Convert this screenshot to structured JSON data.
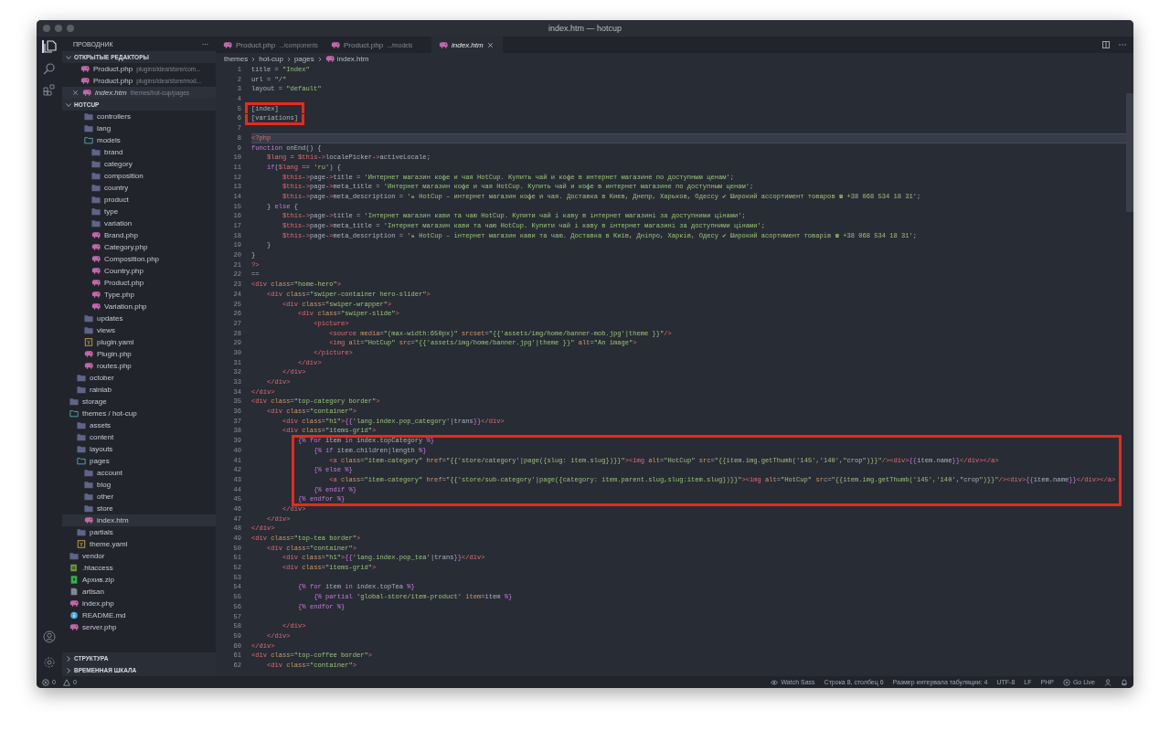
{
  "window": {
    "title": "index.htm — hotcup"
  },
  "sidebar": {
    "title": "ПРОВОДНИК",
    "more": "···",
    "open_editors": {
      "title": "ОТКРЫТЫЕ РЕДАКТОРЫ",
      "expanded": true,
      "items": [
        {
          "kind": "php",
          "name": "Product.php",
          "path": "plugins/idea/store/com...",
          "selected": false,
          "preview": false
        },
        {
          "kind": "php",
          "name": "Product.php",
          "path": "plugins/idea/store/mod...",
          "selected": false,
          "preview": false
        },
        {
          "kind": "php",
          "name": "index.htm",
          "path": "themes/hot-cup/pages",
          "selected": true,
          "preview": true
        }
      ]
    },
    "project": {
      "title": "HOTCUP",
      "expanded": true,
      "tree": [
        {
          "children": [
            {
              "children": [
                {
                  "kind": "folder",
                  "label": "controllers",
                  "expanded": false,
                  "selected": false
                },
                {
                  "kind": "folder",
                  "label": "lang",
                  "expanded": false,
                  "selected": false
                },
                {
                  "kind": "folder",
                  "label": "models",
                  "expanded": true,
                  "selected": false,
                  "children": [
                    {
                      "kind": "folder",
                      "label": "brand",
                      "expanded": false,
                      "selected": false
                    },
                    {
                      "kind": "folder",
                      "label": "category",
                      "expanded": false,
                      "selected": false
                    },
                    {
                      "kind": "folder",
                      "label": "composition",
                      "expanded": false,
                      "selected": false
                    },
                    {
                      "kind": "folder",
                      "label": "country",
                      "expanded": false,
                      "selected": false
                    },
                    {
                      "kind": "folder",
                      "label": "product",
                      "expanded": false,
                      "selected": false
                    },
                    {
                      "kind": "folder",
                      "label": "type",
                      "expanded": false,
                      "selected": false
                    },
                    {
                      "kind": "folder",
                      "label": "variation",
                      "expanded": false,
                      "selected": false
                    },
                    {
                      "kind": "php",
                      "label": "Brand.php",
                      "selected": false
                    },
                    {
                      "kind": "php",
                      "label": "Category.php",
                      "selected": false
                    },
                    {
                      "kind": "php",
                      "label": "Composition.php",
                      "selected": false
                    },
                    {
                      "kind": "php",
                      "label": "Country.php",
                      "selected": false
                    },
                    {
                      "kind": "php",
                      "label": "Product.php",
                      "selected": false
                    },
                    {
                      "kind": "php",
                      "label": "Type.php",
                      "selected": false
                    },
                    {
                      "kind": "php",
                      "label": "Variation.php",
                      "selected": false
                    }
                  ]
                },
                {
                  "kind": "folder",
                  "label": "updates",
                  "expanded": false,
                  "selected": false
                },
                {
                  "kind": "folder",
                  "label": "views",
                  "expanded": false,
                  "selected": false
                },
                {
                  "kind": "yaml",
                  "label": "plugin.yaml",
                  "selected": false
                },
                {
                  "kind": "php",
                  "label": "Plugin.php",
                  "selected": false
                },
                {
                  "kind": "php",
                  "label": "routes.php",
                  "selected": false
                }
              ]
            },
            {
              "kind": "folder",
              "label": "october",
              "expanded": false,
              "selected": false
            },
            {
              "kind": "folder",
              "label": "rainlab",
              "expanded": false,
              "selected": false
            }
          ]
        },
        {
          "kind": "folder",
          "label": "storage",
          "expanded": false,
          "selected": false
        },
        {
          "kind": "folder",
          "label": "themes / hot-cup",
          "expanded": true,
          "selected": false,
          "children": [
            {
              "kind": "folder",
              "label": "assets",
              "expanded": false,
              "selected": false
            },
            {
              "kind": "folder",
              "label": "content",
              "expanded": false,
              "selected": false
            },
            {
              "kind": "folder",
              "label": "layouts",
              "expanded": false,
              "selected": false
            },
            {
              "kind": "folder",
              "label": "pages",
              "expanded": true,
              "selected": false,
              "children": [
                {
                  "kind": "folder",
                  "label": "account",
                  "expanded": false,
                  "selected": false
                },
                {
                  "kind": "folder",
                  "label": "blog",
                  "expanded": false,
                  "selected": false
                },
                {
                  "kind": "folder",
                  "label": "other",
                  "expanded": false,
                  "selected": false
                },
                {
                  "kind": "folder",
                  "label": "store",
                  "expanded": false,
                  "selected": false
                },
                {
                  "kind": "php",
                  "label": "index.htm",
                  "selected": true
                }
              ]
            },
            {
              "kind": "folder",
              "label": "partials",
              "expanded": false,
              "selected": false
            },
            {
              "kind": "yaml",
              "label": "theme.yaml",
              "selected": false
            }
          ]
        },
        {
          "kind": "folder",
          "label": "vendor",
          "expanded": false,
          "selected": false
        },
        {
          "kind": "htaccess",
          "label": ".htaccess",
          "selected": false
        },
        {
          "kind": "zip",
          "label": "Архив.zip",
          "selected": false
        },
        {
          "kind": "file",
          "label": "artisan",
          "selected": false
        },
        {
          "kind": "php",
          "label": "index.php",
          "selected": false
        },
        {
          "kind": "info",
          "label": "README.md",
          "selected": false
        },
        {
          "kind": "php",
          "label": "server.php",
          "selected": false
        }
      ]
    },
    "bottom_sections": [
      {
        "title": "СТРУКТУРА",
        "expanded": false
      },
      {
        "title": "ВРЕМЕННАЯ ШКАЛА",
        "expanded": false
      }
    ]
  },
  "tabs": [
    {
      "kind": "php",
      "label": "Product.php",
      "description": ".../components",
      "selected": false,
      "preview": false
    },
    {
      "kind": "php",
      "label": "Product.php",
      "description": ".../models",
      "selected": false,
      "preview": false
    },
    {
      "kind": "php",
      "label": "index.htm",
      "selected": true,
      "preview": true
    }
  ],
  "breadcrumb": [
    {
      "kind": "folder",
      "label": "themes"
    },
    {
      "kind": "folder",
      "label": "hot-cup"
    },
    {
      "kind": "folder",
      "label": "pages"
    },
    {
      "kind": "php",
      "label": "index.htm"
    }
  ],
  "code_lines": [
    {
      "number": "1",
      "text": "title = \"Index\"",
      "current": false,
      "boxed": false
    },
    {
      "number": "2",
      "text": "url = \"/\"",
      "current": false,
      "boxed": false
    },
    {
      "number": "3",
      "text": "layout = \"default\"",
      "current": false,
      "boxed": false
    },
    {
      "number": "4",
      "current": false,
      "boxed": false
    },
    {
      "number": "5",
      "text": "[index]",
      "current": false,
      "boxed": true
    },
    {
      "number": "6",
      "text": "[variations]",
      "current": false,
      "boxed": true
    },
    {
      "number": "7",
      "current": false,
      "boxed": false
    },
    {
      "number": "8",
      "text": "<?php",
      "current": true,
      "boxed": false
    },
    {
      "number": "9",
      "text": "function onEnd() {",
      "current": false,
      "boxed": false
    },
    {
      "number": "10",
      "text": "    $lang = $this->localePicker->activeLocale;",
      "current": false,
      "boxed": false
    },
    {
      "number": "11",
      "text": "    if($lang == 'ru') {",
      "current": false,
      "boxed": false
    },
    {
      "number": "12",
      "text": "        $this->page->title = 'Интернет магазин кофе и чая HotCup. Купить чай и кофе в интернет магазине по доступным ценам';",
      "current": false,
      "boxed": false
    },
    {
      "number": "13",
      "text": "        $this->page->meta_title = 'Интернет магазин кофе и чая HotCup. Купить чай и кофе в интернет магазине по доступным ценам';",
      "current": false,
      "boxed": false
    },
    {
      "number": "14",
      "text": "        $this->page->meta_description = '☕ HotCup – интернет магазин кофе и чая. Доставка в Киев, Днепр, Харьков, Одессу ✔ Широкий ассортимент товаров ☎ +38 068 534 18 31';",
      "current": false,
      "boxed": false
    },
    {
      "number": "15",
      "text": "    } else {",
      "current": false,
      "boxed": false
    },
    {
      "number": "16",
      "text": "        $this->page->title = 'Інтернет магазин кави та чаю HotCup. Купити чай і каву в інтернет магазині за доступними цінами';",
      "current": false,
      "boxed": false
    },
    {
      "number": "17",
      "text": "        $this->page->meta_title = 'Інтернет магазин кави та чаю HotCup. Купити чай і каву в інтернет магазині за доступними цінами';",
      "current": false,
      "boxed": false
    },
    {
      "number": "18",
      "text": "        $this->page->meta_description = '☕ HotCup – інтернет магазин кави та чаю. Доставка в Київ, Дніпро, Харків, Одесу ✔ Широкий асортимент товарів ☎ +38 068 534 18 31';",
      "current": false,
      "boxed": false
    },
    {
      "number": "19",
      "text": "    }",
      "current": false,
      "boxed": false
    },
    {
      "number": "20",
      "text": "}",
      "current": false,
      "boxed": false
    },
    {
      "number": "21",
      "text": "?>",
      "current": false,
      "boxed": false
    },
    {
      "number": "22",
      "text": "==",
      "current": false,
      "boxed": false
    },
    {
      "number": "23",
      "text": "<div class=\"home-hero\">",
      "current": false,
      "boxed": false
    },
    {
      "number": "24",
      "text": "    <div class=\"swiper-container hero-slider\">",
      "current": false,
      "boxed": false
    },
    {
      "number": "25",
      "text": "        <div class=\"swiper-wrapper\">",
      "current": false,
      "boxed": false
    },
    {
      "number": "26",
      "text": "            <div class=\"swiper-slide\">",
      "current": false,
      "boxed": false
    },
    {
      "number": "27",
      "text": "                <picture>",
      "current": false,
      "boxed": false
    },
    {
      "number": "28",
      "text": "                    <source media=\"(max-width:650px)\" srcset=\"{{'assets/img/home/banner-mob.jpg'|theme }}\"/>",
      "current": false,
      "boxed": false
    },
    {
      "number": "29",
      "text": "                    <img alt=\"HotCup\" src=\"{{'assets/img/home/banner.jpg'|theme }}\" alt=\"An image\">",
      "current": false,
      "boxed": false
    },
    {
      "number": "30",
      "text": "                </picture>",
      "current": false,
      "boxed": false
    },
    {
      "number": "31",
      "text": "            </div>",
      "current": false,
      "boxed": false
    },
    {
      "number": "32",
      "text": "        </div>",
      "current": false,
      "boxed": false
    },
    {
      "number": "33",
      "text": "    </div>",
      "current": false,
      "boxed": false
    },
    {
      "number": "34",
      "text": "</div>",
      "current": false,
      "boxed": false
    },
    {
      "number": "35",
      "text": "<div class=\"top-category border\">",
      "current": false,
      "boxed": false
    },
    {
      "number": "36",
      "text": "    <div class=\"container\">",
      "current": false,
      "boxed": false
    },
    {
      "number": "37",
      "text": "        <div class=\"h1\">{{'lang.index.pop_category'|trans}}</div>",
      "current": false,
      "boxed": false
    },
    {
      "number": "38",
      "text": "        <div class=\"items-grid\">",
      "current": false,
      "boxed": false
    },
    {
      "number": "39",
      "text": "            {% for item in index.topCategory %}",
      "current": false,
      "boxed": true
    },
    {
      "number": "40",
      "text": "                {% if item.children|length %}",
      "current": false,
      "boxed": true
    },
    {
      "number": "41",
      "text": "                    <a class=\"item-category\" href=\"{{'store/category'|page({slug: item.slug})}}\"><img alt=\"HotCup\" src=\"{{item.img.getThumb('145','140',\"crop\")}}\"/><div>{{item.name}}</div></a>",
      "current": false,
      "boxed": true
    },
    {
      "number": "42",
      "text": "                {% else %}",
      "current": false,
      "boxed": true
    },
    {
      "number": "43",
      "text": "                    <a class=\"item-category\" href=\"{{'store/sub-category'|page({category: item.parent.slug,slug:item.slug})}}\"><img alt=\"HotCup\" src=\"{{item.img.getThumb('145','140',\"crop\")}}\"/><div>{{item.name}}</div></a>",
      "current": false,
      "boxed": true
    },
    {
      "number": "44",
      "text": "                {% endif %}",
      "current": false,
      "boxed": true
    },
    {
      "number": "45",
      "text": "            {% endfor %}",
      "current": false,
      "boxed": true
    },
    {
      "number": "46",
      "text": "        </div>",
      "current": false,
      "boxed": false
    },
    {
      "number": "47",
      "text": "    </div>",
      "current": false,
      "boxed": false
    },
    {
      "number": "48",
      "text": "</div>",
      "current": false,
      "boxed": false
    },
    {
      "number": "49",
      "text": "<div class=\"top-tea border\">",
      "current": false,
      "boxed": false
    },
    {
      "number": "50",
      "text": "    <div class=\"container\">",
      "current": false,
      "boxed": false
    },
    {
      "number": "51",
      "text": "        <div class=\"h1\">{{'lang.index.pop_tea'|trans}}</div>",
      "current": false,
      "boxed": false
    },
    {
      "number": "52",
      "text": "        <div class=\"items-grid\">",
      "current": false,
      "boxed": false
    },
    {
      "number": "53",
      "current": false,
      "boxed": false
    },
    {
      "number": "54",
      "text": "            {% for item in index.topTea %}",
      "current": false,
      "boxed": false
    },
    {
      "number": "55",
      "text": "                {% partial 'global-store/item-product' item=item %}",
      "current": false,
      "boxed": false
    },
    {
      "number": "56",
      "text": "            {% endfor %}",
      "current": false,
      "boxed": false
    },
    {
      "number": "57",
      "current": false,
      "boxed": false
    },
    {
      "number": "58",
      "text": "        </div>",
      "current": false,
      "boxed": false
    },
    {
      "number": "59",
      "text": "    </div>",
      "current": false,
      "boxed": false
    },
    {
      "number": "60",
      "text": "</div>",
      "current": false,
      "boxed": false
    },
    {
      "number": "61",
      "text": "<div class=\"top-coffee border\">",
      "current": false,
      "boxed": false
    },
    {
      "number": "62",
      "text": "    <div class=\"container\">",
      "current": false,
      "boxed": false
    }
  ],
  "status_bar": {
    "problems": [
      {
        "kind": "error",
        "count": "0"
      },
      {
        "kind": "warning",
        "count": "0"
      }
    ],
    "items": [
      {
        "kind": "eye",
        "label": "Watch Sass"
      },
      {
        "kind": "text",
        "label": "Строка 8, столбец 6"
      },
      {
        "kind": "text",
        "label": "Размер интервала табуляции: 4"
      },
      {
        "kind": "text",
        "label": "UTF-8"
      },
      {
        "kind": "text",
        "label": "LF"
      },
      {
        "kind": "text",
        "label": "PHP"
      },
      {
        "kind": "broadcast",
        "label": "Go Live"
      }
    ]
  }
}
